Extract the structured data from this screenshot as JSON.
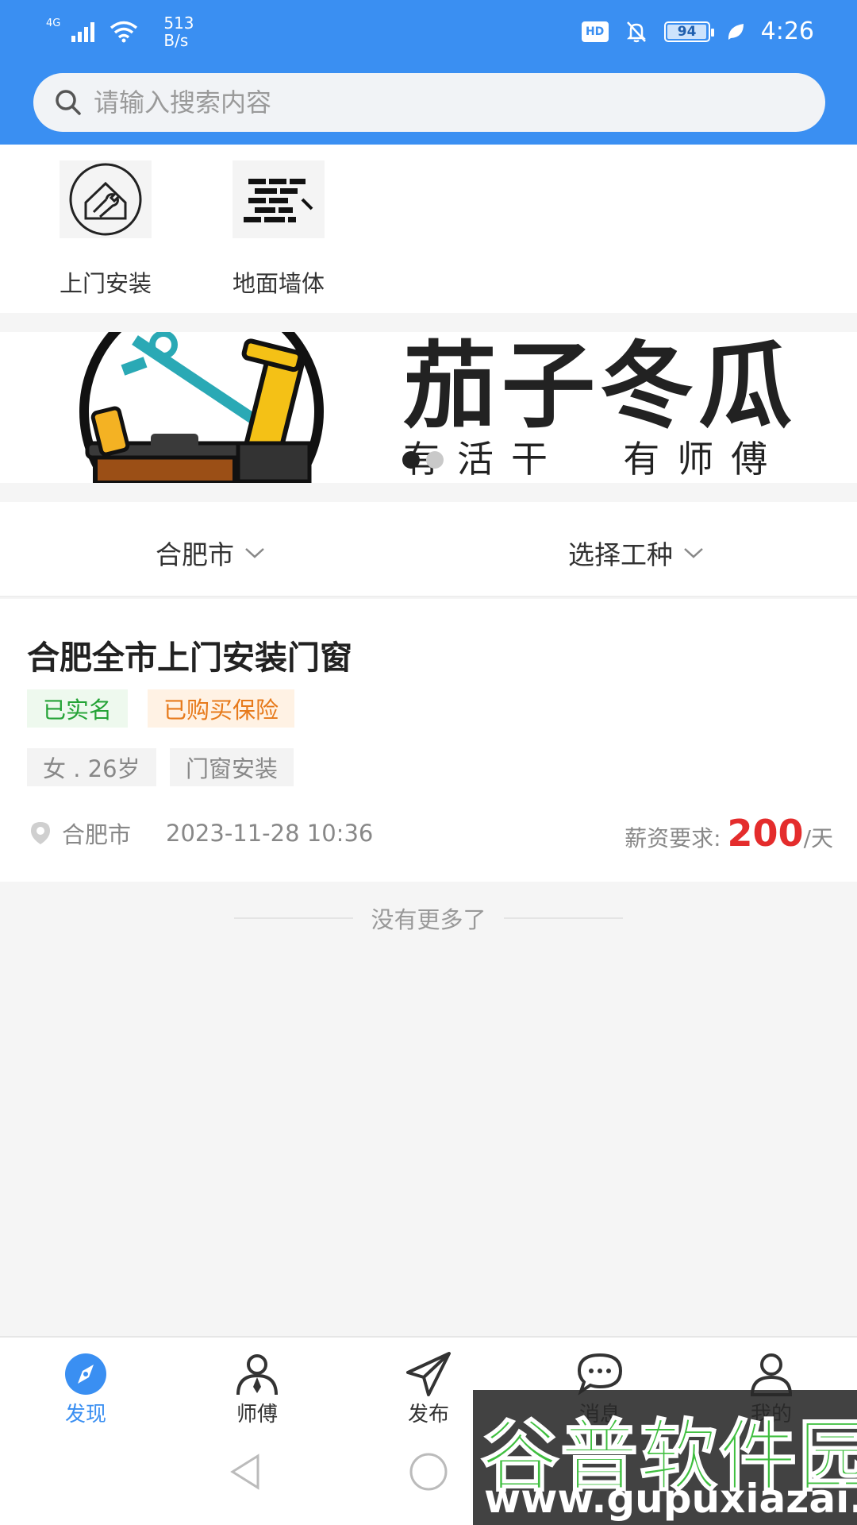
{
  "status_bar": {
    "network": "4G",
    "speed_value": "513",
    "speed_unit": "B/s",
    "hd": "HD",
    "battery": "94",
    "time": "4:26"
  },
  "search": {
    "placeholder": "请输入搜索内容"
  },
  "categories": [
    {
      "label": "上门安装",
      "icon": "house-wrench-icon"
    },
    {
      "label": "地面墙体",
      "icon": "brick-wall-icon"
    }
  ],
  "banner": {
    "title": "茄子冬瓜",
    "subtitle": "有活干  有师傅",
    "slide_count": 2,
    "active_slide": 1
  },
  "filters": {
    "city": "合肥市",
    "trade": "选择工种"
  },
  "job": {
    "title": "合肥全市上门安装门窗",
    "badges": [
      "已实名",
      "已购买保险"
    ],
    "tags": [
      "女 . 26岁",
      "门窗安装"
    ],
    "location": "合肥市",
    "datetime": "2023-11-28 10:36",
    "salary_label": "薪资要求:",
    "salary_value": "200",
    "salary_unit": "/天"
  },
  "list_end_text": "没有更多了",
  "tabbar": [
    {
      "label": "发现",
      "icon": "compass-icon",
      "active": true
    },
    {
      "label": "师傅",
      "icon": "worker-icon",
      "active": false
    },
    {
      "label": "发布",
      "icon": "send-icon",
      "active": false
    },
    {
      "label": "消息",
      "icon": "chat-icon",
      "active": false
    },
    {
      "label": "我的",
      "icon": "user-icon",
      "active": false
    }
  ],
  "watermark": {
    "name": "谷普软件园",
    "url": "www.gupuxiazai.com"
  },
  "colors": {
    "primary": "#3a8ff2",
    "price": "#e42c2c",
    "badge_green": "#24a336",
    "badge_orange": "#e77a1b"
  }
}
